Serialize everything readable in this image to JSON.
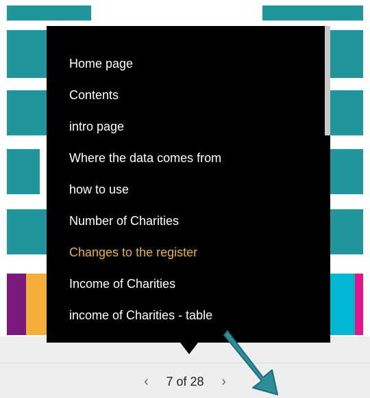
{
  "menu": {
    "items": [
      {
        "label": "Home page",
        "current": false
      },
      {
        "label": "Contents",
        "current": false
      },
      {
        "label": "intro page",
        "current": false
      },
      {
        "label": "Where the data comes from",
        "current": false
      },
      {
        "label": "how to use",
        "current": false
      },
      {
        "label": "Number of Charities",
        "current": false
      },
      {
        "label": "Changes to the register",
        "current": true
      },
      {
        "label": "Income of Charities",
        "current": false
      },
      {
        "label": "income of Charities - table",
        "current": false
      }
    ]
  },
  "pager": {
    "prev_icon": "‹",
    "next_icon": "›",
    "text": "7 of 28"
  },
  "colors": {
    "teal": "#20969c",
    "purple": "#7b1a7e",
    "orange": "#f5ad3a",
    "cyan": "#00b7d1",
    "magenta": "#e0188c",
    "highlight": "#e8b33b",
    "arrow": "#2d8e9c"
  }
}
